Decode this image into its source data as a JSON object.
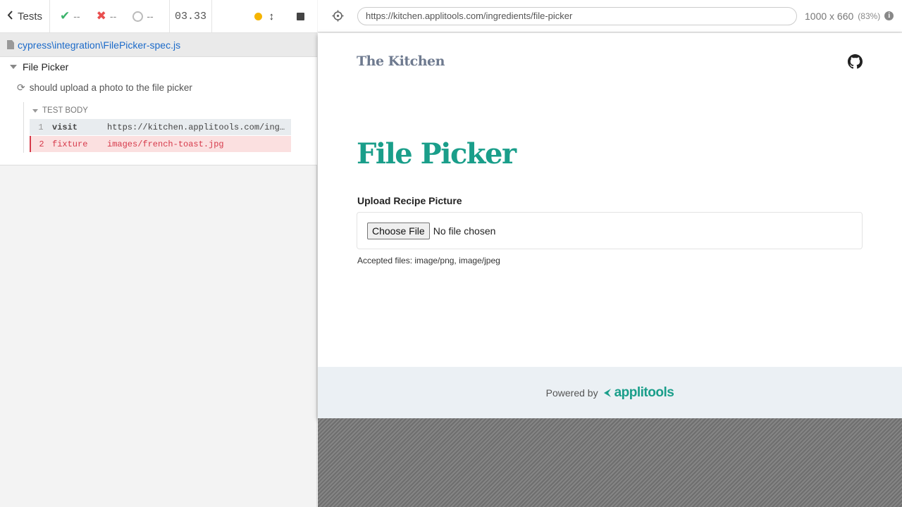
{
  "toolbar": {
    "tests_label": "Tests",
    "passed": "--",
    "failed": "--",
    "pending": "--",
    "duration": "03.33",
    "icons": {
      "back": "chevron-left-icon",
      "passed": "check-icon",
      "failed": "x-icon",
      "pending": "ring-icon",
      "running": "dot-icon",
      "scroll": "arrows-vertical-icon",
      "stop": "stop-icon"
    },
    "colors": {
      "passed": "#3bb36b",
      "failed": "#e94f4f",
      "running": "#f5b400"
    }
  },
  "spec": {
    "path": "cypress\\integration\\FilePicker-spec.js",
    "icon": "file-icon"
  },
  "reporter": {
    "suite_title": "File Picker",
    "test_title": "should upload a photo to the file picker",
    "test_body_label": "TEST BODY",
    "commands": [
      {
        "number": "1",
        "name": "visit",
        "message": "https://kitchen.applitools.com/ingredients/file-picker"
      },
      {
        "number": "2",
        "name": "fixture",
        "message": "images/french-toast.jpg"
      }
    ]
  },
  "aut_header": {
    "url": "https://kitchen.applitools.com/ingredients/file-picker",
    "viewport": "1000 x 660",
    "scale": "(83%)",
    "icons": {
      "selector": "crosshair-icon",
      "info": "info-icon"
    }
  },
  "app": {
    "brand": "The Kitchen",
    "github_icon": "github-icon",
    "page_title": "File Picker",
    "field_label": "Upload Recipe Picture",
    "choose_button": "Choose File",
    "no_file_text": "No file chosen",
    "help_text": "Accepted files: image/png, image/jpeg",
    "footer": {
      "powered_by": "Powered by",
      "logo_text": "applitools"
    },
    "colors": {
      "accent": "#1a9e8a",
      "brand": "#6e7a8f",
      "footer_bg": "#ebf0f4"
    }
  }
}
